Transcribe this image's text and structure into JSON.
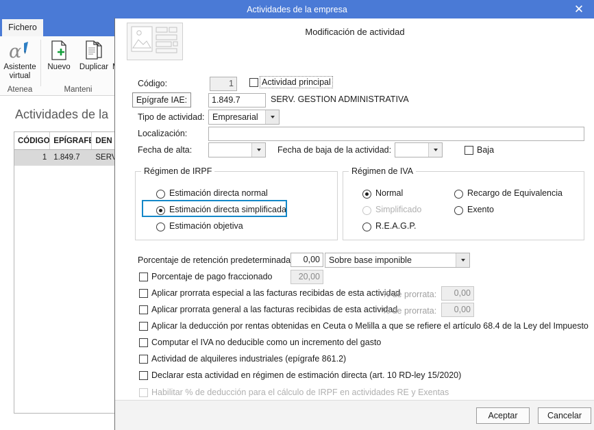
{
  "window": {
    "title": "Actividades de la empresa",
    "close_label": "✕"
  },
  "ribbon": {
    "tab_fichero": "Fichero",
    "groups": [
      {
        "label": "Atenea",
        "items": [
          {
            "label": "Asistente\nvirtual",
            "icon": "alpha-pen-icon"
          }
        ]
      },
      {
        "label": "Manteni",
        "items": [
          {
            "label": "Nuevo",
            "icon": "new-document-icon"
          },
          {
            "label": "Duplicar",
            "icon": "duplicate-document-icon"
          },
          {
            "label": "Mo",
            "icon": "modify-document-icon"
          }
        ]
      }
    ],
    "item_asistente": "Asistente",
    "item_asistente_2": "virtual",
    "item_nuevo": "Nuevo",
    "item_duplicar": "Duplicar",
    "item_modificar": "Mo",
    "group_atenea": "Atenea",
    "group_mantenimiento": "Manteni"
  },
  "list_panel": {
    "title": "Actividades de la",
    "columns": [
      "CÓDIGO",
      "EPÍGRAFE",
      "DEN"
    ],
    "rows": [
      {
        "codigo": "1",
        "epigrafe": "1.849.7",
        "denominacion": "SERV"
      }
    ]
  },
  "dialog": {
    "title": "Modificación de actividad",
    "expander": "❯",
    "fields": {
      "codigo_label": "Código:",
      "codigo_value": "1",
      "actividad_principal_label": "Actividad principal",
      "epigrafe_button": "Epígrafe IAE:",
      "epigrafe_value": "1.849.7",
      "epigrafe_description": "SERV. GESTION ADMINISTRATIVA",
      "tipo_actividad_label": "Tipo de actividad:",
      "tipo_actividad_value": "Empresarial",
      "localizacion_label": "Localización:",
      "localizacion_value": "",
      "fecha_alta_label": "Fecha de alta:",
      "fecha_alta_value": "",
      "fecha_baja_label": "Fecha de baja de la actividad:",
      "fecha_baja_value": "",
      "baja_label": "Baja"
    },
    "irpf": {
      "legend": "Régimen de IRPF",
      "options": [
        {
          "label": "Estimación directa normal",
          "selected": false,
          "disabled": false,
          "highlighted": false
        },
        {
          "label": "Estimación directa simplificada",
          "selected": true,
          "disabled": false,
          "highlighted": true
        },
        {
          "label": "Estimación objetiva",
          "selected": false,
          "disabled": false,
          "highlighted": false
        }
      ]
    },
    "iva": {
      "legend": "Régimen de IVA",
      "options_left": [
        {
          "label": "Normal",
          "selected": true,
          "disabled": false
        },
        {
          "label": "Simplificado",
          "selected": false,
          "disabled": true
        },
        {
          "label": "R.E.A.G.P.",
          "selected": false,
          "disabled": false
        }
      ],
      "options_right": [
        {
          "label": "Recargo de Equivalencia",
          "selected": false,
          "disabled": false
        },
        {
          "label": "Exento",
          "selected": false,
          "disabled": false
        }
      ]
    },
    "retencion": {
      "label": "Porcentaje de retención predeterminada:",
      "value": "0,00",
      "base_option": "Sobre base imponible"
    },
    "pago_fraccionado": {
      "label": "Porcentaje de pago fraccionado",
      "value": "20,00",
      "checked": false
    },
    "prorrata_especial": {
      "label": "Aplicar prorrata especial a las facturas recibidas de esta actividad",
      "percent_label": "% de prorrata:",
      "percent_value": "0,00",
      "checked": false
    },
    "prorrata_general": {
      "label": "Aplicar prorrata general a las facturas recibidas de esta actividad",
      "percent_label": "% de prorrata:",
      "percent_value": "0,00",
      "checked": false
    },
    "checks": [
      {
        "label": "Aplicar la deducción por rentas obtenidas en Ceuta o Melilla a que se refiere el artículo 68.4 de la Ley del Impuesto",
        "checked": false,
        "disabled": false
      },
      {
        "label": "Computar el IVA no deducible como un incremento del gasto",
        "checked": false,
        "disabled": false
      },
      {
        "label": "Actividad de alquileres industriales (epígrafe 861.2)",
        "checked": false,
        "disabled": false
      },
      {
        "label": "Declarar esta actividad en régimen de estimación directa (art. 10 RD-ley 15/2020)",
        "checked": false,
        "disabled": false
      },
      {
        "label": "Habilitar % de deducción para el cálculo de IRPF en actividades RE y Exentas",
        "checked": false,
        "disabled": true
      }
    ],
    "footer": {
      "accept": "Aceptar",
      "cancel": "Cancelar"
    }
  },
  "colors": {
    "titlebar_blue": "#4a7ad6",
    "highlight_blue": "#1387c8",
    "row_selected": "#d9d9d9",
    "footer_bg": "#f3f3f3"
  }
}
